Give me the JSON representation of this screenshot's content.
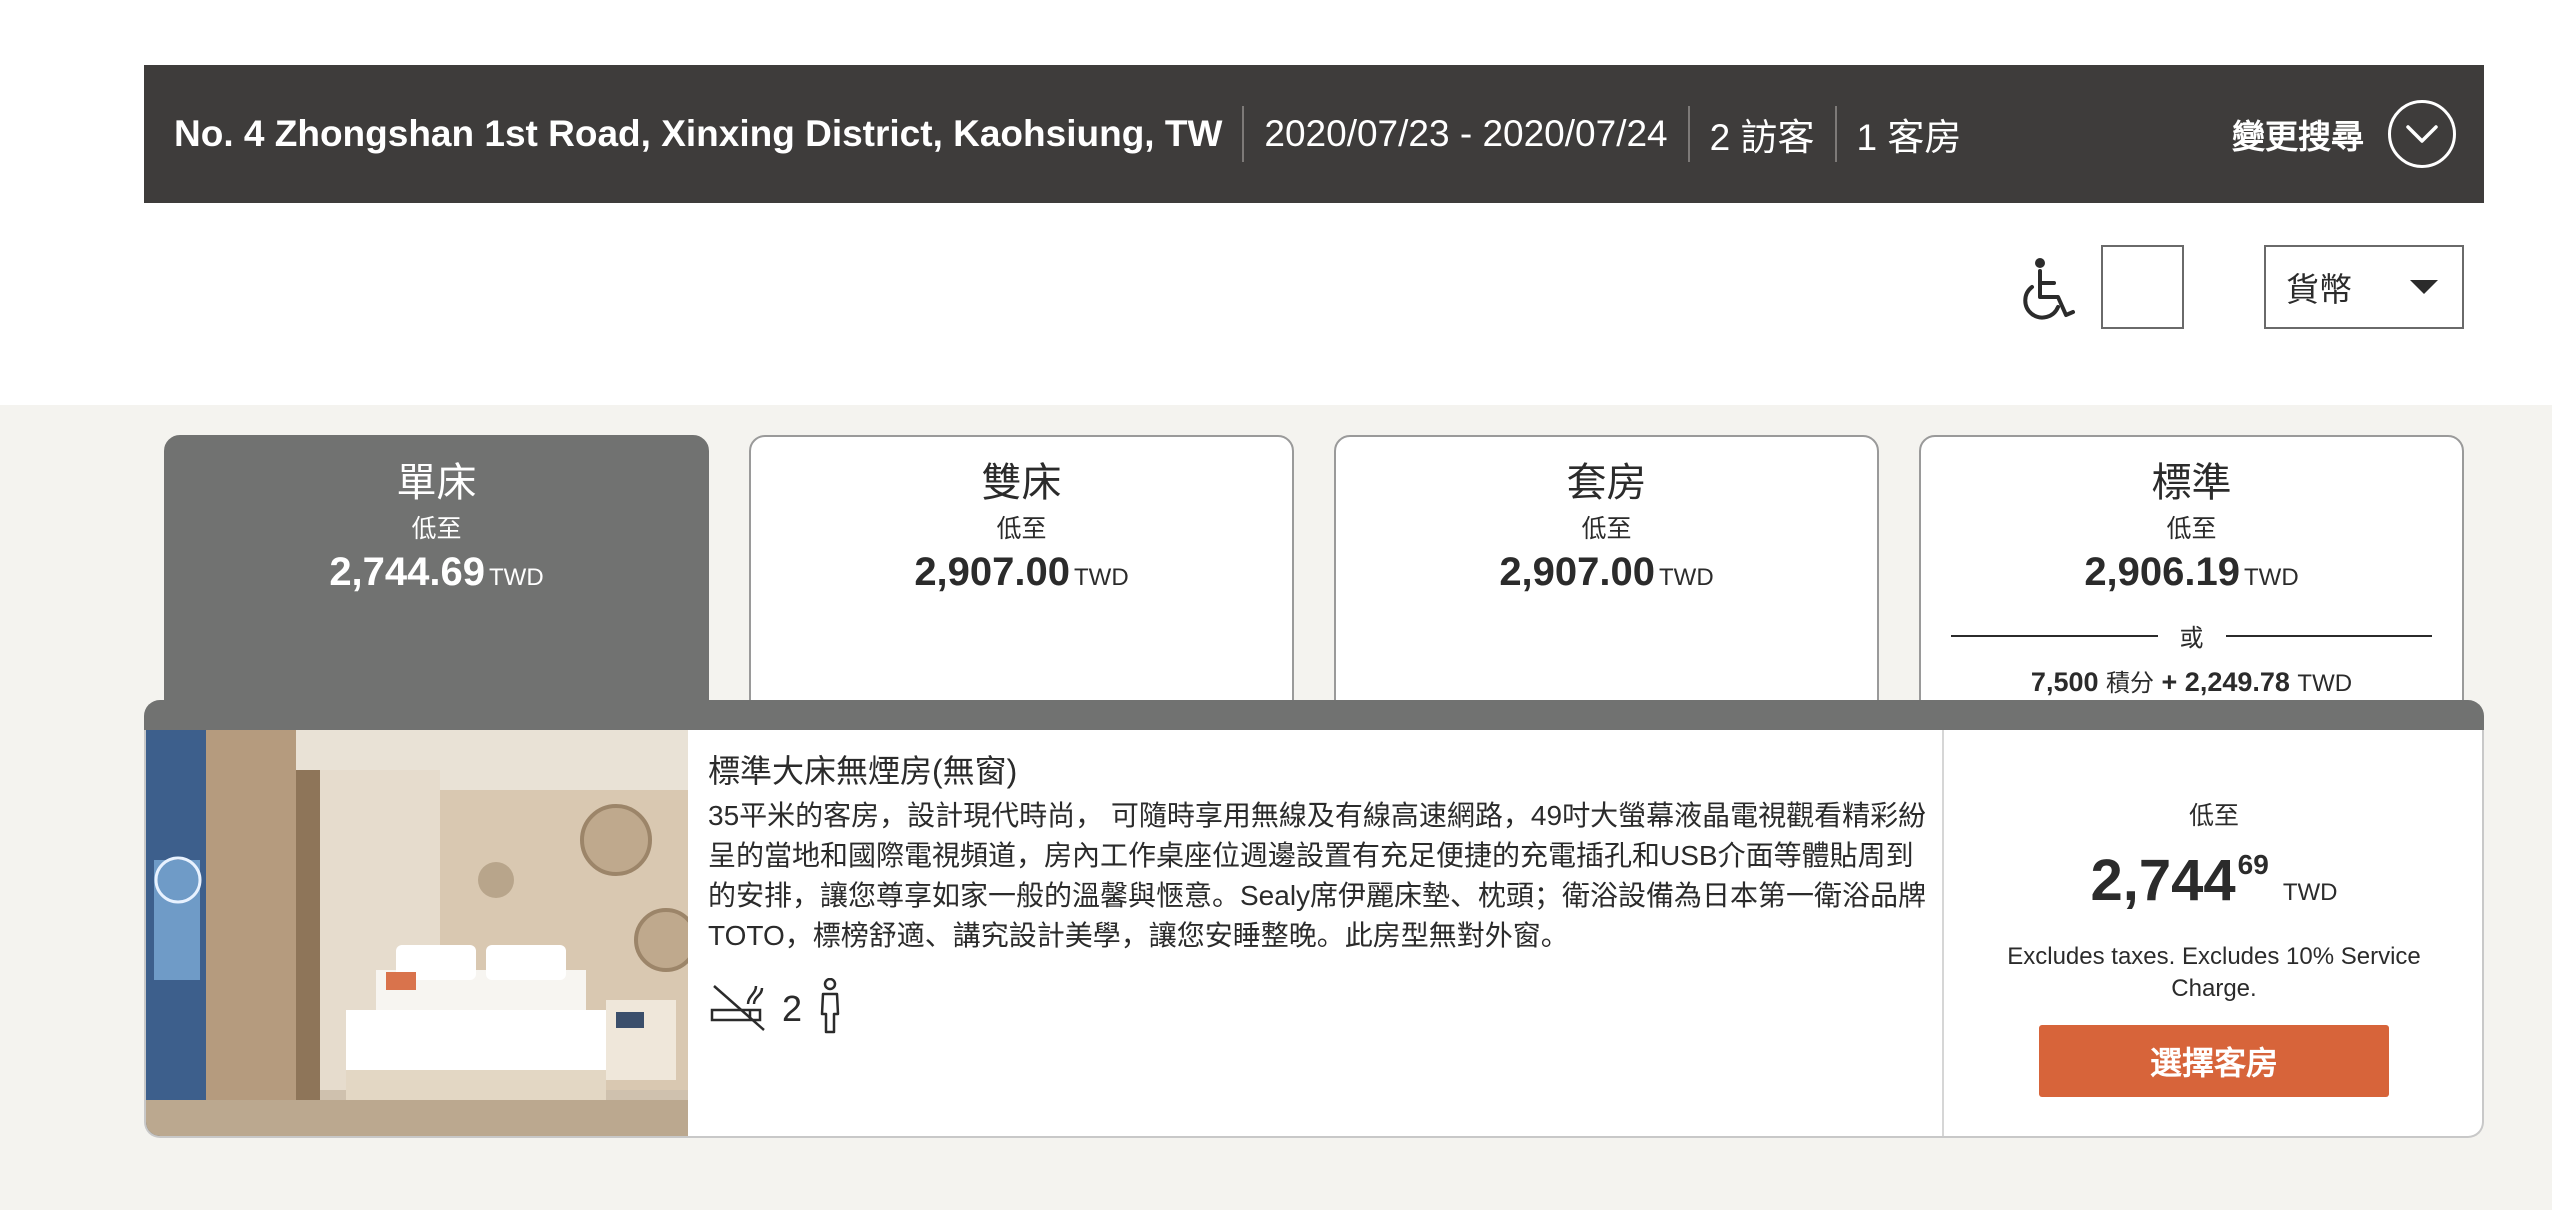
{
  "search": {
    "address": "No. 4 Zhongshan 1st Road, Xinxing District, Kaohsiung, TW",
    "dates": "2020/07/23 - 2020/07/24",
    "guests": "2 訪客",
    "rooms": "1 客房",
    "change_label": "變更搜尋",
    "toggle_icon": "chevron-down-icon"
  },
  "filters": {
    "accessibility_icon": "wheelchair-icon",
    "currency_label": "貨幣"
  },
  "tabs": [
    {
      "name": "單床",
      "from_label": "低至",
      "price": "2,744.69",
      "currency": "TWD",
      "active": true
    },
    {
      "name": "雙床",
      "from_label": "低至",
      "price": "2,907.00",
      "currency": "TWD",
      "active": false
    },
    {
      "name": "套房",
      "from_label": "低至",
      "price": "2,907.00",
      "currency": "TWD",
      "active": false
    },
    {
      "name": "標準",
      "from_label": "低至",
      "price": "2,906.19",
      "currency": "TWD",
      "active": false,
      "or_label": "或",
      "points": "7,500",
      "points_label": "積分",
      "points_plus": "+ 2,249.78",
      "points_currency": "TWD"
    }
  ],
  "room": {
    "title": "標準大床無煙房(無窗)",
    "description": "35平米的客房，設計現代時尚， 可隨時享用無線及有線高速網路，49吋大螢幕液晶電視觀看精彩紛呈的當地和國際電視頻道，房內工作桌座位週邊設置有充足便捷的充電插孔和USB介面等體貼周到的安排，讓您尊享如家一般的溫馨與愜意。Sealy席伊麗床墊、枕頭；衛浴設備為日本第一衛浴品牌TOTO，標榜舒適、講究設計美學，讓您安睡整晚。此房型無對外窗。",
    "amenity_icons": [
      "no-smoking-icon",
      "person-icon"
    ],
    "occupancy": "2",
    "from_label": "低至",
    "price_main": "2,744",
    "price_cents": "69",
    "currency": "TWD",
    "tax_note": "Excludes taxes. Excludes 10% Service Charge.",
    "select_label": "選擇客房"
  },
  "colors": {
    "header_bg": "#3e3c3b",
    "active_tab": "#717271",
    "section_bg": "#f4f3ef",
    "cta": "#d7643a"
  }
}
